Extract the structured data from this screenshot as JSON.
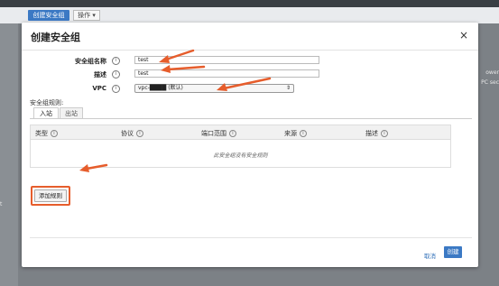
{
  "background": {
    "create_button_label": "创建安全组",
    "ops_button_label": "操作 ▾",
    "right_text_1": "ower",
    "right_text_2": "PC sec",
    "left_text": "t"
  },
  "modal": {
    "title": "创建安全组",
    "close_symbol": "×",
    "fields": {
      "name_label": "安全组名称",
      "name_value": "test",
      "desc_label": "描述",
      "desc_value": "test",
      "vpc_label": "VPC",
      "vpc_selected": "vpc-████ (默认)"
    },
    "info_symbol": "i",
    "rules_label": "安全组规则:",
    "tabs": [
      "入站",
      "出站"
    ],
    "table": {
      "columns": [
        "类型",
        "协议",
        "端口范围",
        "来源",
        "描述"
      ],
      "empty_message": "此安全组没有安全规则"
    },
    "add_rule_label": "添加规则",
    "cancel_label": "取消",
    "create_label": "创建"
  },
  "colors": {
    "accent": "#3b79c4",
    "annotation_arrow": "#e65d2c"
  }
}
